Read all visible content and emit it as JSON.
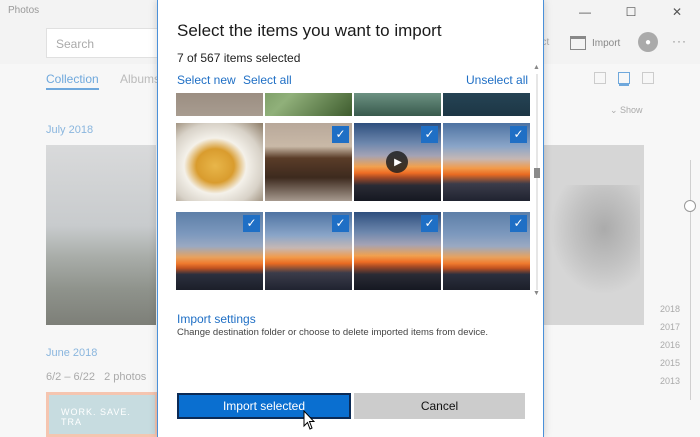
{
  "app": {
    "title": "Photos",
    "search_placeholder": "Search",
    "select_label": "ect",
    "import_label": "Import",
    "tabs": [
      {
        "label": "Collection",
        "active": true
      },
      {
        "label": "Albums",
        "active": false
      }
    ],
    "show_label": "Show",
    "sections": [
      {
        "month": "July 2018"
      },
      {
        "month": "June 2018",
        "range": "6/2 – 6/22",
        "count": "2 photos"
      }
    ],
    "banner_text": "WORK. SAVE. TRA",
    "timeline_years": [
      "2018",
      "2017",
      "2016",
      "2015",
      "2013"
    ],
    "window_buttons": [
      "—",
      "☐",
      "✕"
    ]
  },
  "dialog": {
    "title": "Select the items you want to import",
    "count_text": "7 of 567 items selected",
    "select_new": "Select new",
    "select_all": "Select all",
    "unselect_all": "Unselect all",
    "thumbnails": [
      {
        "id": "r0c0",
        "kind": "crowd",
        "selected": false
      },
      {
        "id": "r0c1",
        "kind": "grass",
        "selected": false
      },
      {
        "id": "r0c2",
        "kind": "sea",
        "selected": false
      },
      {
        "id": "r0c3",
        "kind": "darksea",
        "selected": false
      },
      {
        "id": "r1c0",
        "kind": "food",
        "selected": false
      },
      {
        "id": "r1c1",
        "kind": "drinks",
        "selected": true
      },
      {
        "id": "r1c2",
        "kind": "sunset-video",
        "selected": true
      },
      {
        "id": "r1c3",
        "kind": "sunset",
        "selected": true
      },
      {
        "id": "r2c0",
        "kind": "sunset",
        "selected": true
      },
      {
        "id": "r2c1",
        "kind": "sunset",
        "selected": true
      },
      {
        "id": "r2c2",
        "kind": "sunset",
        "selected": true
      },
      {
        "id": "r2c3",
        "kind": "sunset",
        "selected": true
      }
    ],
    "import_settings_label": "Import settings",
    "import_settings_desc": "Change destination folder or choose to delete imported items from device.",
    "import_button": "Import selected",
    "cancel_button": "Cancel"
  },
  "colors": {
    "accent": "#1f6fc5",
    "primary_button": "#0a6fd0",
    "cancel_button": "#cccccc"
  }
}
